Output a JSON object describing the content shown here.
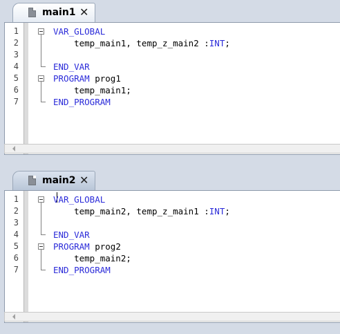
{
  "tabs": [
    {
      "label": "main1",
      "close": "✕",
      "active": true,
      "lines": [
        {
          "n": "1",
          "parts": [
            {
              "t": "VAR_GLOBAL",
              "k": true
            }
          ]
        },
        {
          "n": "2",
          "parts": [
            {
              "t": "    temp_main1, temp_z_main2 :",
              "k": false
            },
            {
              "t": "INT",
              "k": true
            },
            {
              "t": ";",
              "k": false
            }
          ]
        },
        {
          "n": "3",
          "parts": []
        },
        {
          "n": "4",
          "parts": [
            {
              "t": "END_VAR",
              "k": true
            }
          ]
        },
        {
          "n": "5",
          "parts": [
            {
              "t": "PROGRAM",
              "k": true
            },
            {
              "t": " prog1",
              "k": false
            }
          ]
        },
        {
          "n": "6",
          "parts": [
            {
              "t": "    temp_main1;",
              "k": false
            }
          ]
        },
        {
          "n": "7",
          "parts": [
            {
              "t": "END_PROGRAM",
              "k": true
            }
          ]
        }
      ]
    },
    {
      "label": "main2",
      "close": "✕",
      "active": false,
      "lines": [
        {
          "n": "1",
          "parts": [
            {
              "t": "VAR_GLOBAL",
              "k": true
            }
          ]
        },
        {
          "n": "2",
          "parts": [
            {
              "t": "    temp_main2, temp_z_main1 :",
              "k": false
            },
            {
              "t": "INT",
              "k": true
            },
            {
              "t": ";",
              "k": false
            }
          ]
        },
        {
          "n": "3",
          "parts": []
        },
        {
          "n": "4",
          "parts": [
            {
              "t": "END_VAR",
              "k": true
            }
          ]
        },
        {
          "n": "5",
          "parts": [
            {
              "t": "PROGRAM",
              "k": true
            },
            {
              "t": " prog2",
              "k": false
            }
          ]
        },
        {
          "n": "6",
          "parts": [
            {
              "t": "    temp_main2;",
              "k": false
            }
          ]
        },
        {
          "n": "7",
          "parts": [
            {
              "t": "END_PROGRAM",
              "k": true
            }
          ]
        }
      ]
    }
  ],
  "icons": {
    "file": "file-icon",
    "close": "close-icon",
    "fold": "fold-collapse-icon",
    "scroll_left": "scroll-left-arrow-icon"
  }
}
